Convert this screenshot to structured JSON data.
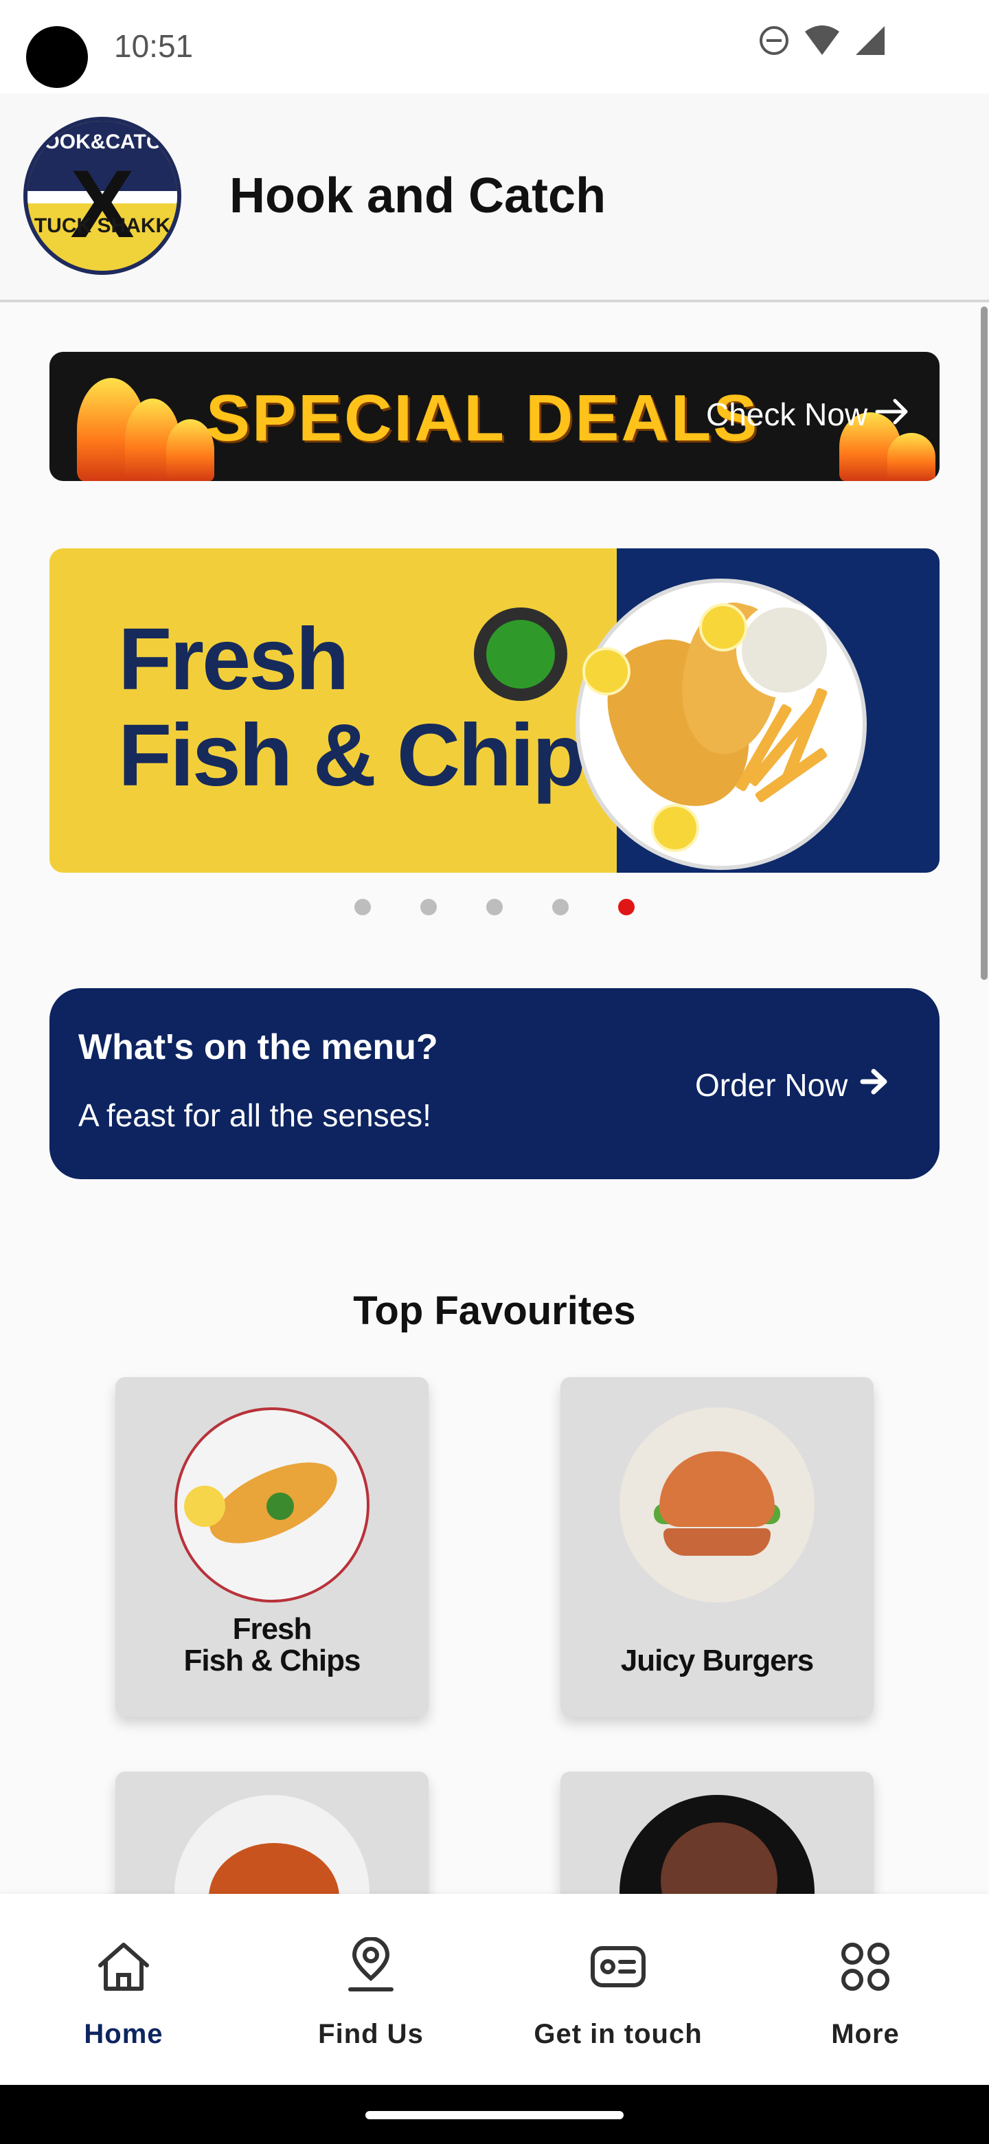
{
  "status_bar": {
    "time": "10:51"
  },
  "header": {
    "title": "Hook and Catch",
    "logo": {
      "top_text": "HOOK&CATCH",
      "bottom_text": "TUCK SHAKK"
    }
  },
  "deals_banner": {
    "title": "SPECIAL DEALS",
    "cta": "Check Now"
  },
  "hero": {
    "line1": "Fresh",
    "line2": "Fish & Chips"
  },
  "carousel": {
    "count": 5,
    "active_index": 4
  },
  "menu_card": {
    "title": "What's on the menu?",
    "subtitle": "A feast for all the senses!",
    "cta": "Order Now"
  },
  "favourites": {
    "title": "Top Favourites",
    "items": [
      {
        "label_line1": "Fresh",
        "label_line2": "Fish & Chips",
        "icon": "fish-and-chips"
      },
      {
        "label_line1": "",
        "label_line2": "Juicy Burgers",
        "icon": "burger"
      },
      {
        "label_line1": "",
        "label_line2": "",
        "icon": "chicken-wings"
      },
      {
        "label_line1": "",
        "label_line2": "",
        "icon": "chocolate-cake"
      }
    ]
  },
  "bottom_nav": {
    "items": [
      {
        "label": "Home",
        "icon": "home-icon",
        "active": true
      },
      {
        "label": "Find Us",
        "icon": "location-pin-icon",
        "active": false
      },
      {
        "label": "Get in touch",
        "icon": "contact-card-icon",
        "active": false
      },
      {
        "label": "More",
        "icon": "grid-more-icon",
        "active": false
      }
    ]
  },
  "colors": {
    "primary_navy": "#0d2460",
    "active_dot": "#e01616",
    "banner_yellow": "#f2cf3a",
    "deal_orange": "#ffc21a"
  }
}
